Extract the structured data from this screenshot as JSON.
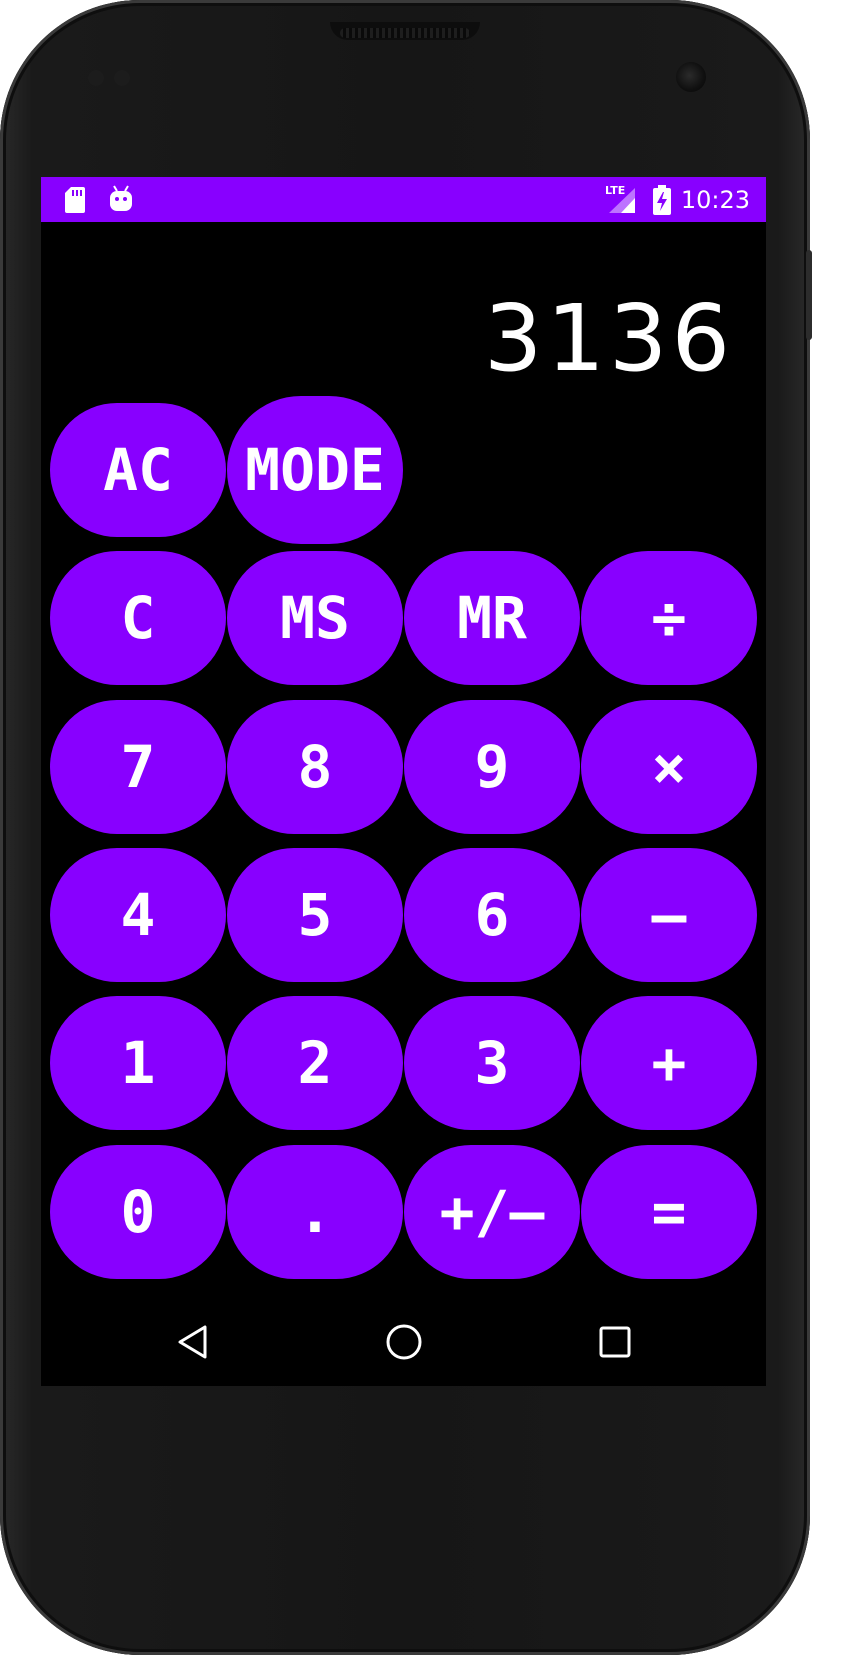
{
  "status_bar": {
    "time": "10:23",
    "network_label": "LTE",
    "color": "#8800ff",
    "icons": [
      "sd-card-icon",
      "android-debug-icon",
      "lte-signal-icon",
      "battery-charging-icon"
    ]
  },
  "display": {
    "value": "3136"
  },
  "keypad": {
    "accent_color": "#8800ff",
    "rows": [
      [
        "AC",
        "MODE"
      ],
      [
        "C",
        "MS",
        "MR",
        "÷"
      ],
      [
        "7",
        "8",
        "9",
        "×"
      ],
      [
        "4",
        "5",
        "6",
        "–"
      ],
      [
        "1",
        "2",
        "3",
        "+"
      ],
      [
        "0",
        ".",
        "+/–",
        "="
      ]
    ]
  },
  "nav_bar": {
    "icons": [
      "back-icon",
      "home-icon",
      "recents-icon"
    ]
  }
}
